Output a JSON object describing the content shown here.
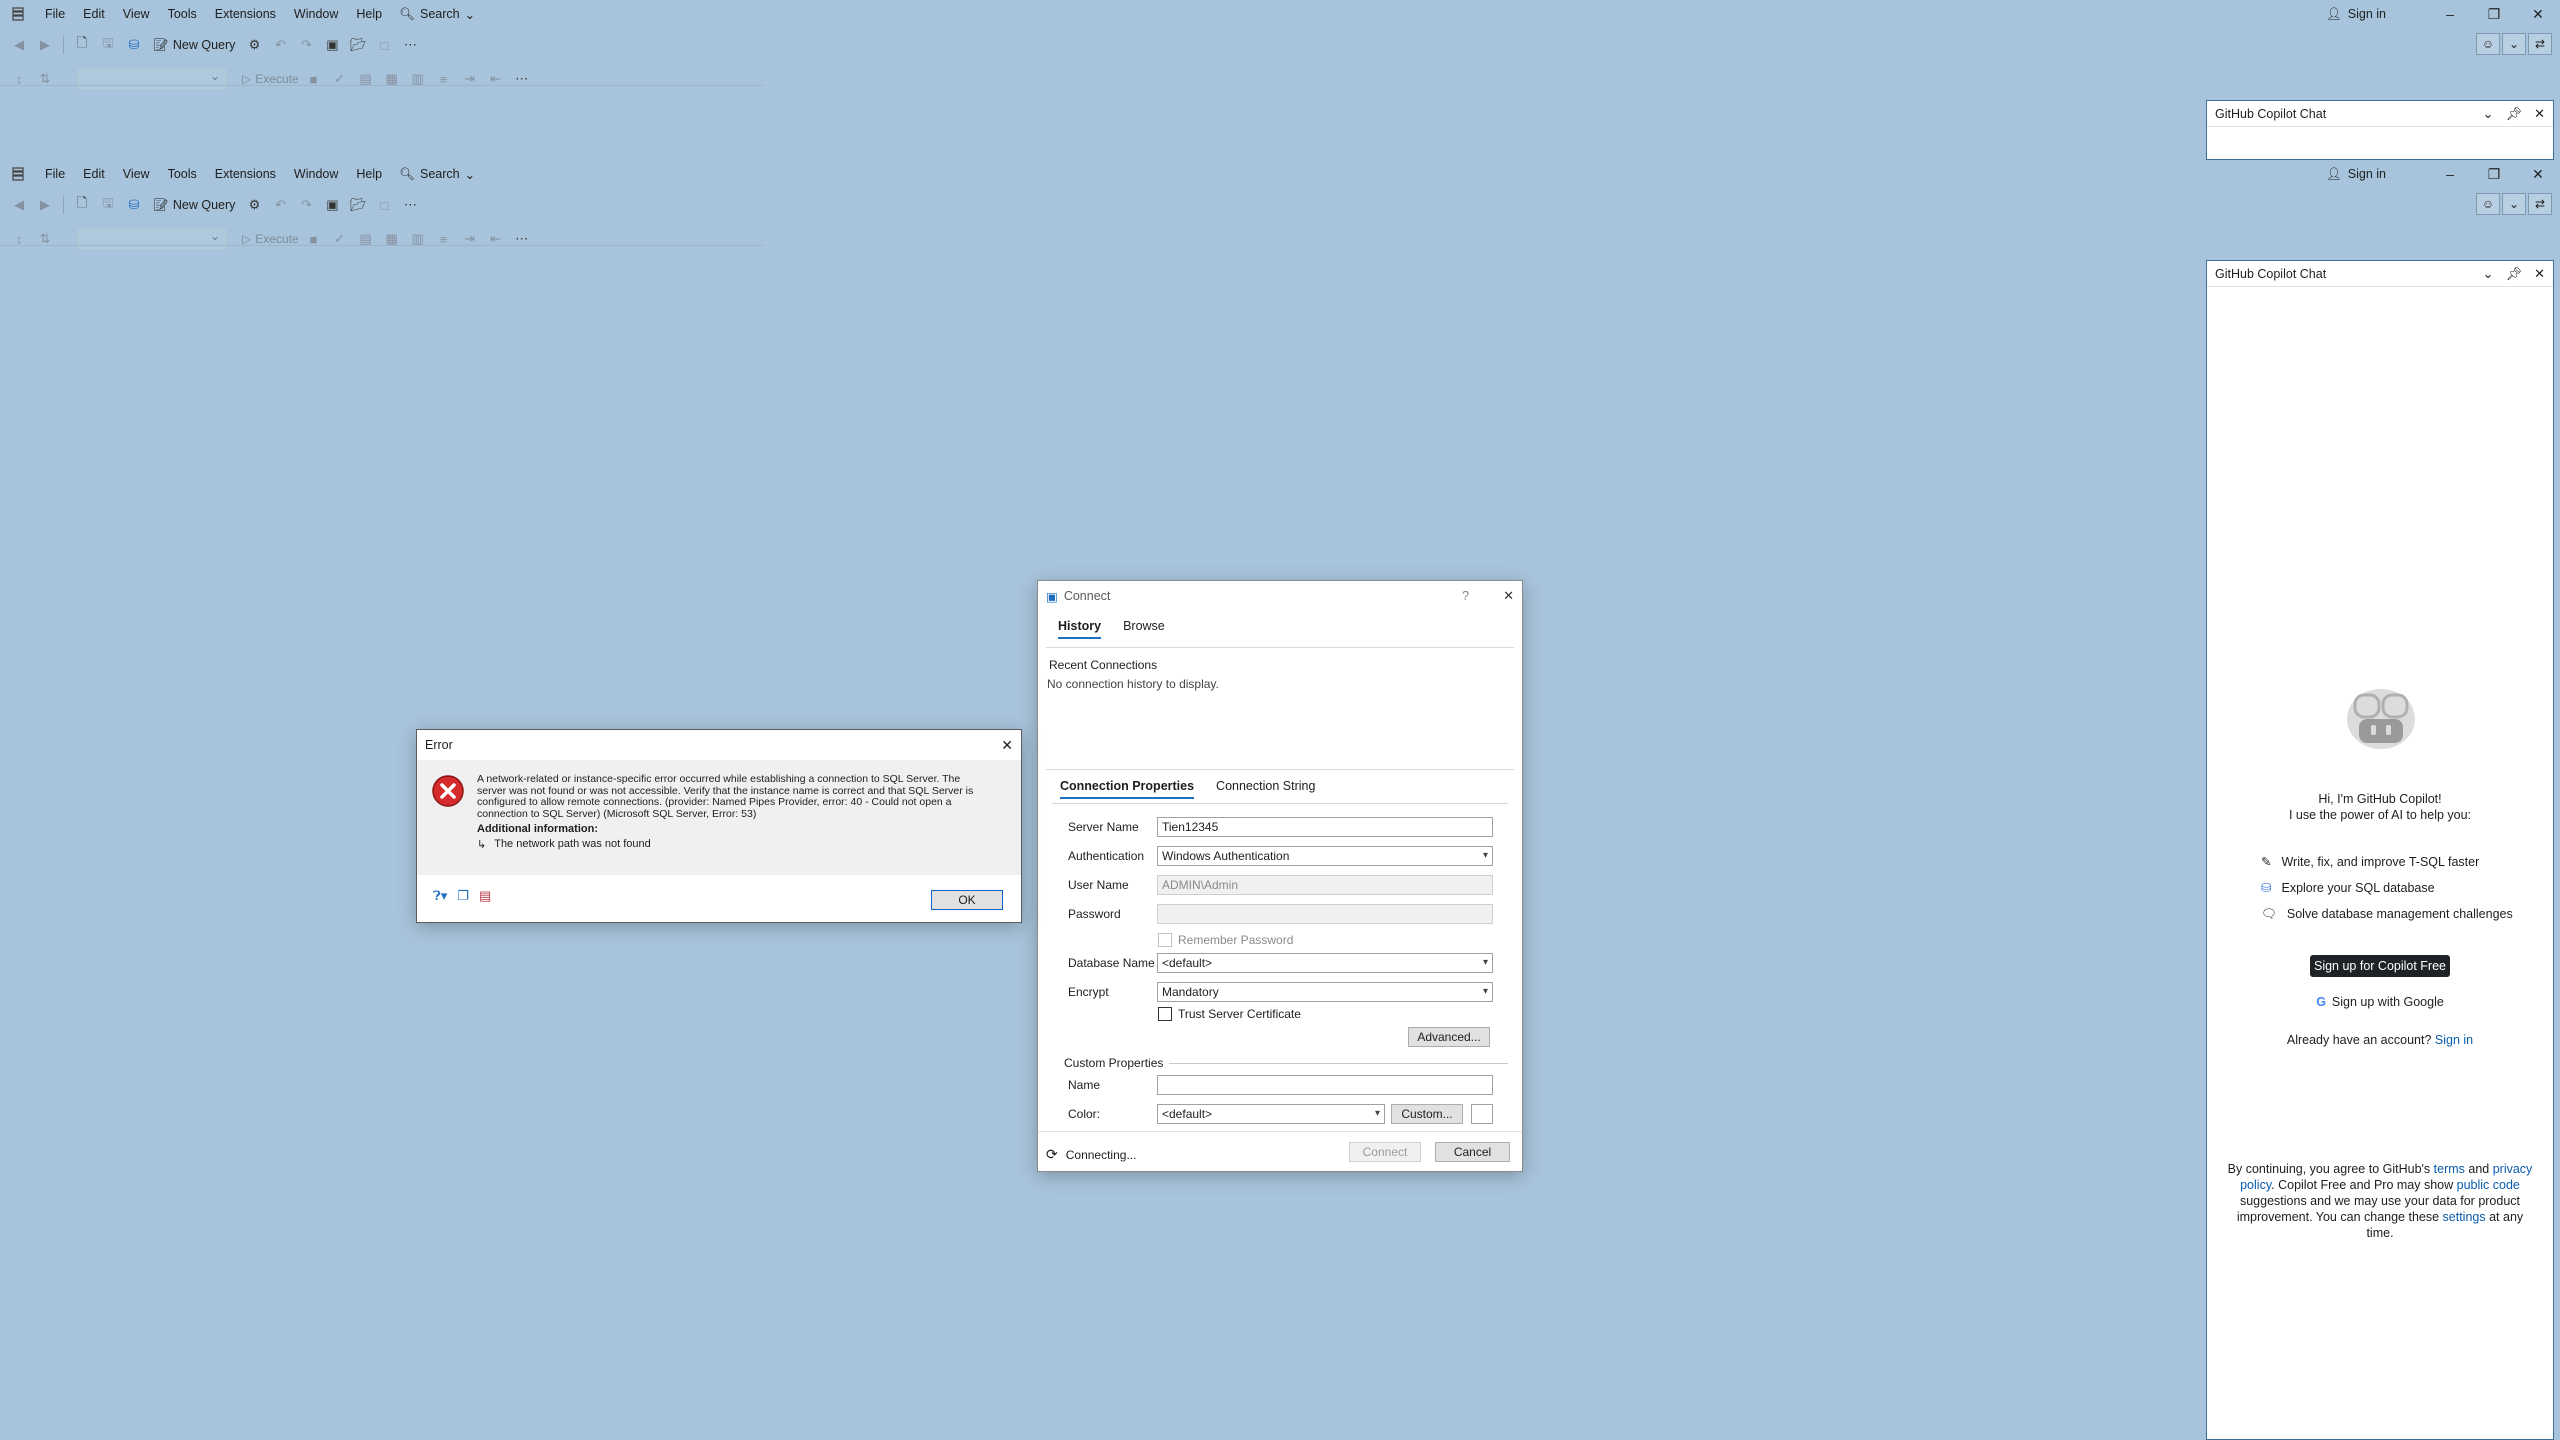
{
  "menu": {
    "items": [
      "File",
      "Edit",
      "View",
      "Tools",
      "Extensions",
      "Window",
      "Help"
    ],
    "search_label": "Search",
    "signin_label": "Sign in"
  },
  "toolbar": {
    "new_query_label": "New Query",
    "execute_label": "Execute"
  },
  "copilot": {
    "title": "GitHub Copilot Chat",
    "greeting_line1": "Hi, I'm GitHub Copilot!",
    "greeting_line2": "I use the power of AI to help you:",
    "features": [
      "Write, fix, and improve T-SQL faster",
      "Explore your SQL database",
      "Solve database management challenges"
    ],
    "signup_free_label": "Sign up for Copilot Free",
    "signup_google_label": "Sign up with Google",
    "have_account_text": "Already have an account?",
    "signin_link": "Sign in",
    "footer": {
      "p1": "By continuing, you agree to GitHub's ",
      "terms": "terms",
      "and": " and ",
      "privacy": "privacy policy",
      "p2": ". Copilot Free and Pro may show ",
      "public_code": "public code",
      "p3": " suggestions and we may use your data for product improvement. You can change these ",
      "settings": "settings",
      "p4": " at any time."
    }
  },
  "error_dialog": {
    "title": "Error",
    "message": "A network-related or instance-specific error occurred while establishing a connection to SQL Server. The server was not found or was not accessible. Verify that the instance name is correct and that SQL Server is configured to allow remote connections. (provider: Named Pipes Provider, error: 40 - Could not open a connection to SQL Server) (Microsoft SQL Server, Error: 53)",
    "additional_info_label": "Additional information:",
    "additional_info_item": "The network path was not found",
    "ok_label": "OK"
  },
  "connect_dialog": {
    "title": "Connect",
    "help": "?",
    "tabs": [
      "History",
      "Browse"
    ],
    "recent_connections_label": "Recent Connections",
    "no_history_text": "No connection history to display.",
    "prop_tabs": [
      "Connection Properties",
      "Connection String"
    ],
    "server_name_label": "Server Name",
    "server_name_value": "Tien12345",
    "authentication_label": "Authentication",
    "authentication_value": "Windows Authentication",
    "user_name_label": "User Name",
    "user_name_value": "ADMIN\\Admin",
    "password_label": "Password",
    "remember_password_label": "Remember Password",
    "database_name_label": "Database Name",
    "database_name_value": "<default>",
    "encrypt_label": "Encrypt",
    "encrypt_value": "Mandatory",
    "trust_cert_label": "Trust Server Certificate",
    "advanced_label": "Advanced...",
    "custom_properties_label": "Custom Properties",
    "name_label": "Name",
    "color_label": "Color:",
    "color_value": "<default>",
    "custom_button_label": "Custom...",
    "status_text": "Connecting...",
    "connect_label": "Connect",
    "cancel_label": "Cancel"
  },
  "colors": {
    "desktop_bg": "#a8c4dc",
    "accent": "#0b5cad",
    "signup_button_bg": "#1f2328",
    "error_red": "#d62b2b"
  }
}
